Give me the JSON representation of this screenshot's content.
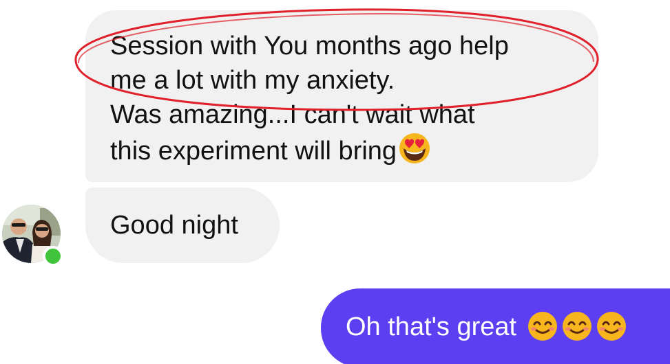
{
  "conversation": {
    "messages": [
      {
        "sender": "contact",
        "lines": [
          "Session with You months ago help",
          "me a lot with my anxiety.",
          "Was amazing...I can't wait what",
          "this experiment will bring"
        ],
        "trailing_emoji": "smiling-face-with-heart-eyes-icon"
      },
      {
        "sender": "contact",
        "text": "Good night"
      },
      {
        "sender": "me",
        "text": "Oh that's great",
        "trailing_emoji": [
          "smiling-face-icon",
          "smiling-face-icon",
          "smiling-face-icon"
        ]
      }
    ],
    "contact": {
      "online": true
    }
  },
  "colors": {
    "incoming_bubble": "#f1f1f1",
    "outgoing_bubble": "#5b3ff0",
    "online_indicator": "#3fc43c",
    "annotation_circle": "#e0202a"
  }
}
